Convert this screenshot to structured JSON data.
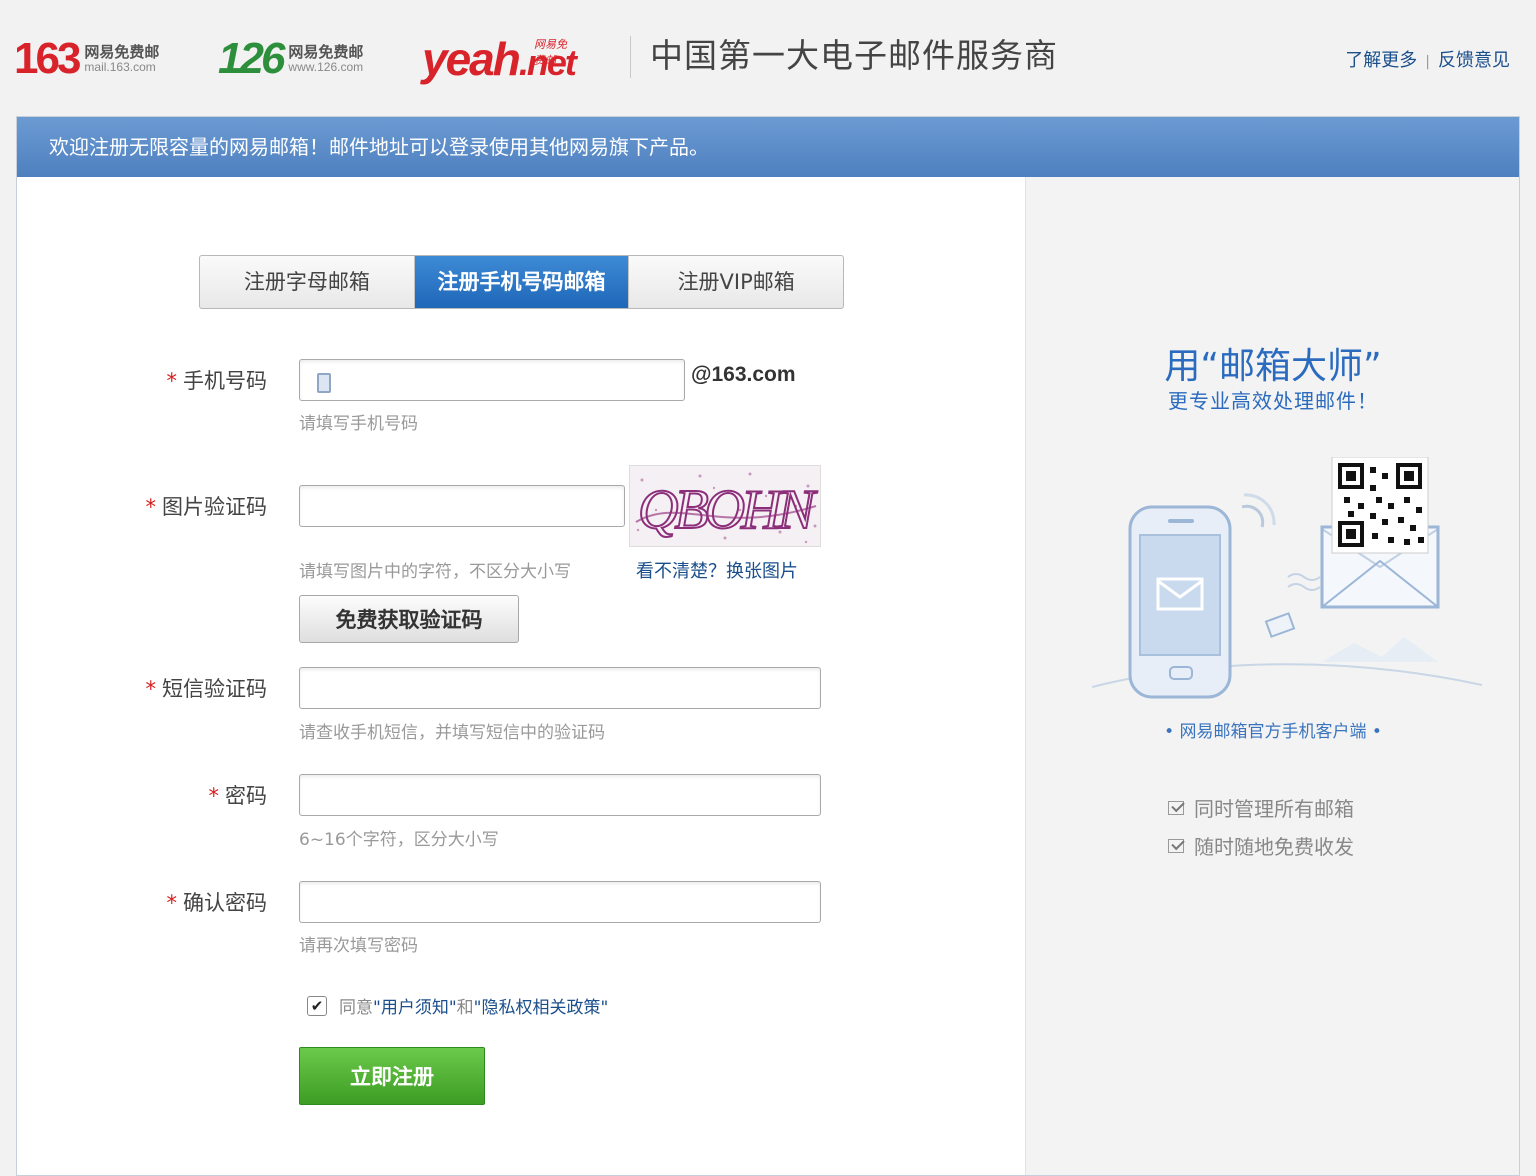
{
  "header": {
    "logo_163": {
      "num": "163",
      "cn": "网易免费邮",
      "domain": "mail.163.com"
    },
    "logo_126": {
      "num": "126",
      "cn": "网易免费邮",
      "domain": "www.126.com"
    },
    "logo_yeah": {
      "text_main": "yeah",
      "text_net": ".net",
      "cn": "网易免费邮"
    },
    "slogan": "中国第一大电子邮件服务商",
    "links": {
      "learn_more": "了解更多",
      "separator": "|",
      "feedback": "反馈意见"
    }
  },
  "banner": "欢迎注册无限容量的网易邮箱！邮件地址可以登录使用其他网易旗下产品。",
  "tabs": [
    {
      "label": "注册字母邮箱",
      "active": false
    },
    {
      "label": "注册手机号码邮箱",
      "active": true
    },
    {
      "label": "注册VIP邮箱",
      "active": false
    }
  ],
  "form": {
    "required_mark": "*",
    "phone": {
      "label": "手机号码",
      "value": "",
      "suffix": "@163.com",
      "hint": "请填写手机号码"
    },
    "captcha": {
      "label": "图片验证码",
      "value": "",
      "hint": "请填写图片中的字符，不区分大小写",
      "refresh_link": "看不清楚？换张图片",
      "image_text": "QBOHN"
    },
    "sms_button": "免费获取验证码",
    "sms_code": {
      "label": "短信验证码",
      "value": "",
      "hint": "请查收手机短信，并填写短信中的验证码"
    },
    "password": {
      "label": "密码",
      "value": "",
      "hint": "6~16个字符，区分大小写"
    },
    "confirm_password": {
      "label": "确认密码",
      "value": "",
      "hint": "请再次填写密码"
    },
    "agreement": {
      "checked": true,
      "check_glyph": "✔",
      "prefix": "同意",
      "terms_link": "\"用户须知\"",
      "and": "和",
      "privacy_link": "\"隐私权相关政策\""
    },
    "submit": "立即注册"
  },
  "promo": {
    "title": "用“邮箱大师”",
    "subtitle": "更专业高效处理邮件！",
    "caption": "• 网易邮箱官方手机客户端 •",
    "features": [
      "同时管理所有邮箱",
      "随时随地免费收发"
    ]
  },
  "colors": {
    "brand_red": "#d9232b",
    "brand_green": "#2d8f3c",
    "link_blue": "#1b4f8c",
    "banner_blue": "#5b8bc8",
    "tab_active": "#2a74c6",
    "register_green": "#4caf32",
    "required_red": "#d51f1f"
  }
}
